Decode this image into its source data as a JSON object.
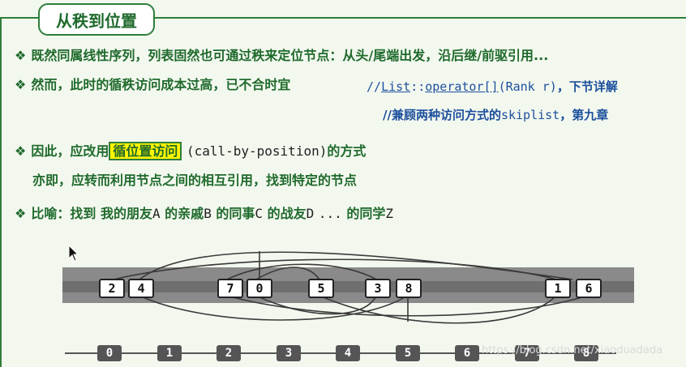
{
  "title": "从秩到位置",
  "lines": {
    "l1": {
      "bullet": "❖",
      "text": "既然同属线性序列，列表固然也可通过秩来定位节点：从头/尾端出发，沿后继/前驱引用..."
    },
    "l2": {
      "bullet": "❖",
      "text": "然而，此时的循秩访问成本过高，已不合时宜",
      "comment_prefix": "//",
      "comment_list": "List",
      "comment_sep": "::",
      "comment_operator": "operator[]",
      "comment_args": "(Rank r)",
      "comment_tail": "，下节详解"
    },
    "l3": {
      "comment": "//兼顾两种访问方式的",
      "comment_code": "skiplist",
      "comment_tail": "，第九章"
    },
    "l4": {
      "bullet": "❖",
      "prefix": "因此，应改用",
      "highlight": "循位置访问",
      "code": "(call-by-position)",
      "suffix": "的方式"
    },
    "l5": {
      "text": "亦即，应转而利用节点之间的相互引用，找到特定的节点"
    },
    "l6": {
      "bullet": "❖",
      "parts": [
        "比喻：找到",
        "我的朋友",
        "A",
        "的亲戚",
        "B",
        "的同事",
        "C",
        "的战友",
        "D",
        "...",
        "的同学",
        "Z"
      ]
    }
  },
  "diagram": {
    "nodes": [
      "2",
      "4",
      "7",
      "0",
      "5",
      "3",
      "8",
      "1",
      "6"
    ],
    "ruler": [
      "0",
      "1",
      "2",
      "3",
      "4",
      "5",
      "6",
      "7",
      "8"
    ]
  },
  "watermark": "https://blog.csdn.net/xiaoduadada"
}
